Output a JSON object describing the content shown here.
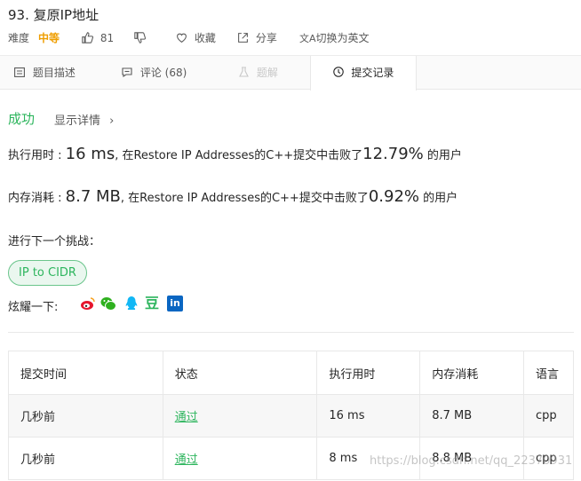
{
  "header": {
    "title": "93. 复原IP地址",
    "difficulty_label": "难度",
    "difficulty": "中等",
    "likes": "81",
    "favorite_label": "收藏",
    "share_label": "分享",
    "translate_label": "切换为英文"
  },
  "tabs": [
    {
      "label": "题目描述",
      "icon": "description-icon"
    },
    {
      "label": "评论 (68)",
      "icon": "comment-icon"
    },
    {
      "label": "题解",
      "icon": "flask-icon",
      "disabled": true
    },
    {
      "label": "提交记录",
      "icon": "clock-icon",
      "active": true
    }
  ],
  "result": {
    "status": "成功",
    "show_details": "显示详情",
    "runtime_label": "执行用时 :",
    "runtime_value": "16 ms",
    "runtime_text": ", 在Restore IP Addresses的C++提交中击败了",
    "runtime_percent": "12.79%",
    "runtime_suffix": " 的用户",
    "memory_label": "内存消耗 :",
    "memory_value": "8.7 MB",
    "memory_text": ", 在Restore IP Addresses的C++提交中击败了",
    "memory_percent": "0.92%",
    "memory_suffix": " 的用户",
    "next_label": "进行下一个挑战：",
    "next_challenge": "IP to CIDR",
    "share_label": "炫耀一下:",
    "share_icons": [
      "weibo-icon",
      "wechat-icon",
      "qq-icon",
      "douban-icon",
      "linkedin-icon"
    ],
    "douban_glyph": "豆",
    "linkedin_glyph": "in"
  },
  "submissions": {
    "headers": [
      "提交时间",
      "状态",
      "执行用时",
      "内存消耗",
      "语言"
    ],
    "rows": [
      [
        "几秒前",
        "通过",
        "16 ms",
        "8.7 MB",
        "cpp"
      ],
      [
        "几秒前",
        "通过",
        "8 ms",
        "8.8 MB",
        "cpp"
      ]
    ]
  },
  "watermark": "https://blog.csdn.net/qq_22370931",
  "colors": {
    "accent": "#2db55d",
    "difficulty": "#ef9e00"
  }
}
